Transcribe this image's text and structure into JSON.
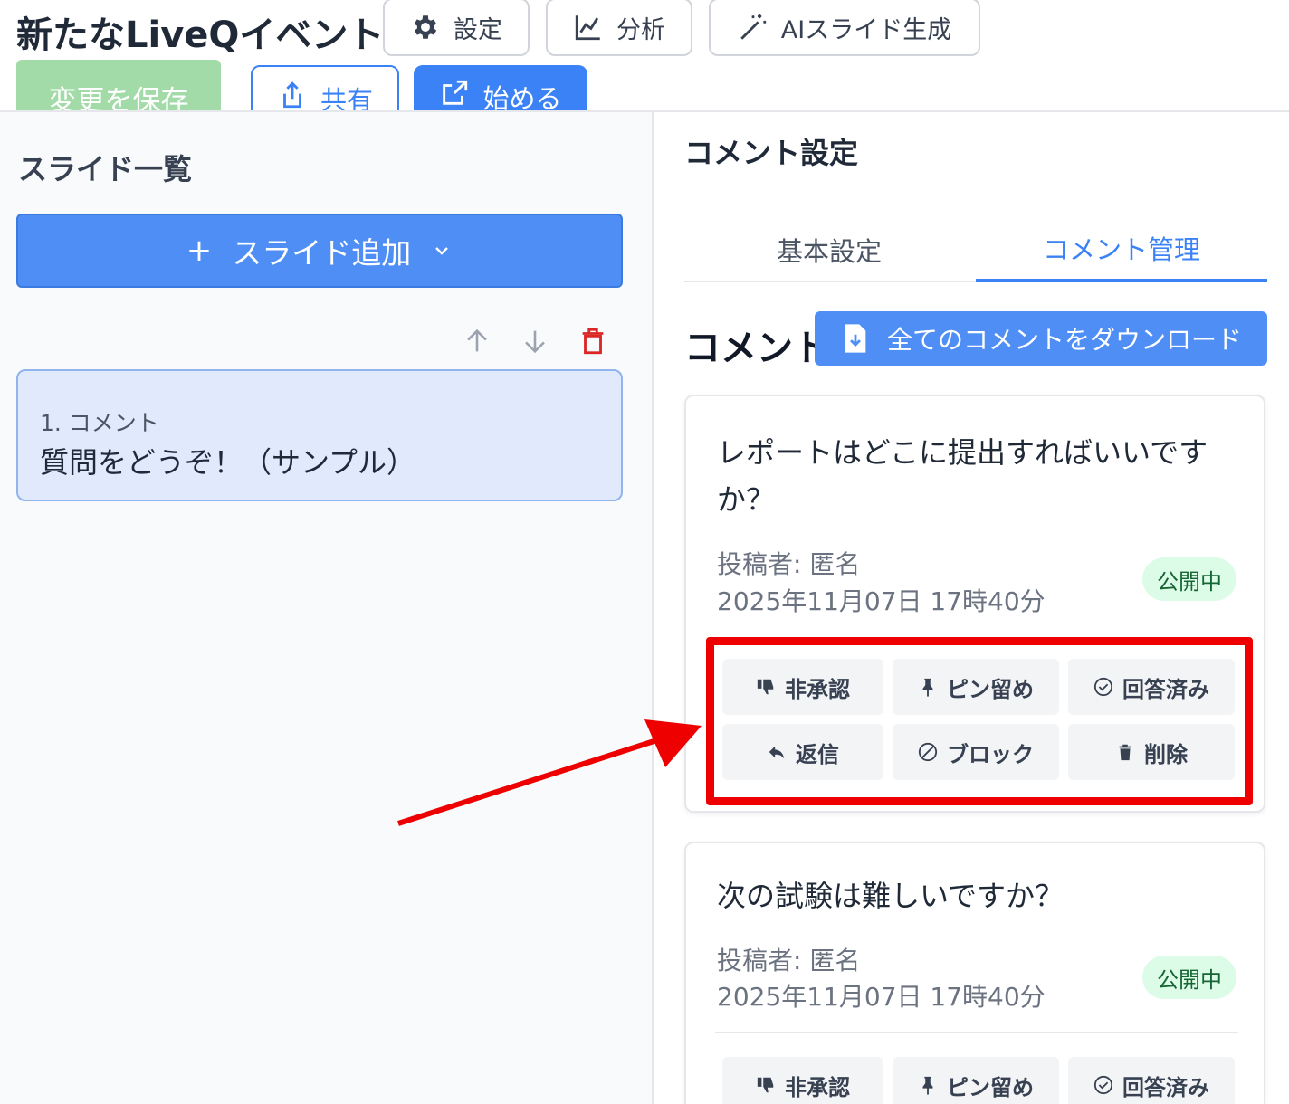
{
  "header": {
    "event_title": "新たなLiveQイベント",
    "settings_label": "設定",
    "analysis_label": "分析",
    "ai_label": "AIスライド生成",
    "save_label": "変更を保存",
    "share_label": "共有",
    "start_label": "始める"
  },
  "left": {
    "title": "スライド一覧",
    "add_slide_label": "スライド追加",
    "slides": [
      {
        "number_label": "1. コメント",
        "text": "質問をどうぞ！（サンプル）"
      }
    ]
  },
  "right": {
    "title": "コメント設定",
    "tabs": [
      {
        "label": "基本設定",
        "active": false
      },
      {
        "label": "コメント管理",
        "active": true
      }
    ],
    "comments_heading": "コメント",
    "download_label": "全てのコメントをダウンロード",
    "comments": [
      {
        "text": "レポートはどこに提出すればいいですか？",
        "author": "投稿者: 匿名",
        "date": "2025年11月07日 17時40分",
        "status": "公開中",
        "actions": {
          "unapprove": "非承認",
          "pin": "ピン留め",
          "answered": "回答済み",
          "reply": "返信",
          "block": "ブロック",
          "delete": "削除"
        }
      },
      {
        "text": "次の試験は難しいですか？",
        "author": "投稿者: 匿名",
        "date": "2025年11月07日 17時40分",
        "status": "公開中",
        "actions": {
          "unapprove": "非承認",
          "pin": "ピン留め",
          "answered": "回答済み"
        }
      }
    ]
  },
  "colors": {
    "primary": "#3b82f6",
    "save_disabled": "#a3dba8",
    "danger": "#dc2626",
    "annotation": "#ee0000",
    "badge_bg": "#dcfce7",
    "badge_text": "#166534"
  }
}
